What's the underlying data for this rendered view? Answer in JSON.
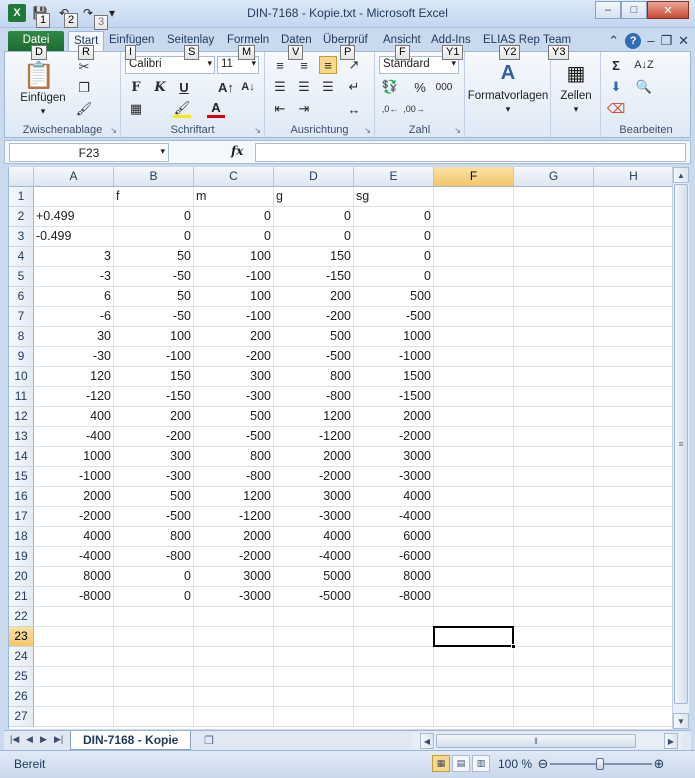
{
  "window": {
    "title": "DIN-7168 - Kopie.txt  -  Microsoft Excel"
  },
  "qat_keytips": [
    "1",
    "2",
    "3"
  ],
  "tabs": [
    {
      "label": "Datei",
      "keytip": "D"
    },
    {
      "label": "Start",
      "keytip": "R"
    },
    {
      "label": "Einfügen",
      "keytip": "I"
    },
    {
      "label": "Seitenlay",
      "keytip": "S"
    },
    {
      "label": "Formeln",
      "keytip": "M"
    },
    {
      "label": "Daten",
      "keytip": "V"
    },
    {
      "label": "Überprüf",
      "keytip": "P"
    },
    {
      "label": "Ansicht",
      "keytip": "F"
    },
    {
      "label": "Add-Ins",
      "keytip": "Y1"
    },
    {
      "label": "ELIAS Rep",
      "keytip": "Y2"
    },
    {
      "label": "Team",
      "keytip": "Y3"
    }
  ],
  "ribbon": {
    "clipboard": {
      "label": "Zwischenablage",
      "paste_label": "Einfügen"
    },
    "font": {
      "label": "Schriftart",
      "font_name": "Calibri",
      "font_size": "11"
    },
    "alignment": {
      "label": "Ausrichtung"
    },
    "number": {
      "label": "Zahl",
      "format": "Standard"
    },
    "styles": {
      "label": "Formatvorlagen"
    },
    "cells": {
      "label": "Zellen"
    },
    "editing": {
      "label": "Bearbeiten"
    }
  },
  "formula_bar": {
    "name_box": "F23",
    "fx": "fx",
    "formula": ""
  },
  "columns": [
    "A",
    "B",
    "C",
    "D",
    "E",
    "F",
    "G",
    "H"
  ],
  "selected_column": "F",
  "rows": [
    "1",
    "2",
    "3",
    "4",
    "5",
    "6",
    "7",
    "8",
    "9",
    "10",
    "11",
    "12",
    "13",
    "14",
    "15",
    "16",
    "17",
    "18",
    "19",
    "20",
    "21",
    "22",
    "23",
    "24",
    "25",
    "26",
    "27"
  ],
  "selected_row": "23",
  "cells": [
    [
      "",
      "f",
      "m",
      "g",
      "sg"
    ],
    [
      "+0.499",
      "0",
      "0",
      "0",
      "0"
    ],
    [
      "-0.499",
      "0",
      "0",
      "0",
      "0"
    ],
    [
      "3",
      "50",
      "100",
      "150",
      "0"
    ],
    [
      "-3",
      "-50",
      "-100",
      "-150",
      "0"
    ],
    [
      "6",
      "50",
      "100",
      "200",
      "500"
    ],
    [
      "-6",
      "-50",
      "-100",
      "-200",
      "-500"
    ],
    [
      "30",
      "100",
      "200",
      "500",
      "1000"
    ],
    [
      "-30",
      "-100",
      "-200",
      "-500",
      "-1000"
    ],
    [
      "120",
      "150",
      "300",
      "800",
      "1500"
    ],
    [
      "-120",
      "-150",
      "-300",
      "-800",
      "-1500"
    ],
    [
      "400",
      "200",
      "500",
      "1200",
      "2000"
    ],
    [
      "-400",
      "-200",
      "-500",
      "-1200",
      "-2000"
    ],
    [
      "1000",
      "300",
      "800",
      "2000",
      "3000"
    ],
    [
      "-1000",
      "-300",
      "-800",
      "-2000",
      "-3000"
    ],
    [
      "2000",
      "500",
      "1200",
      "3000",
      "4000"
    ],
    [
      "-2000",
      "-500",
      "-1200",
      "-3000",
      "-4000"
    ],
    [
      "4000",
      "800",
      "2000",
      "4000",
      "6000"
    ],
    [
      "-4000",
      "-800",
      "-2000",
      "-4000",
      "-6000"
    ],
    [
      "8000",
      "0",
      "3000",
      "5000",
      "8000"
    ],
    [
      "-8000",
      "0",
      "-3000",
      "-5000",
      "-8000"
    ]
  ],
  "sheet_tab": "DIN-7168 - Kopie",
  "status": {
    "ready": "Bereit",
    "zoom": "100 %"
  }
}
